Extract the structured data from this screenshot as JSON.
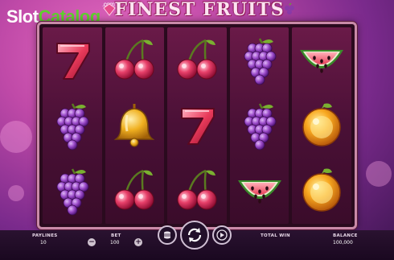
{
  "watermark": {
    "slot": "Slot",
    "catalog": "Catalog",
    "com": ".com"
  },
  "game": {
    "title": "FINEST FRUITS",
    "reels": [
      [
        "seven",
        "grapes",
        "grapes"
      ],
      [
        "cherries",
        "bell",
        "cherries"
      ],
      [
        "cherries",
        "seven",
        "cherries"
      ],
      [
        "grapes",
        "grapes",
        "watermelon"
      ],
      [
        "watermelon",
        "orange",
        "orange"
      ]
    ]
  },
  "controls": {
    "paylines_label": "PAYLINES",
    "paylines_value": "10",
    "bet_label": "BET",
    "bet_value": "100",
    "minus_label": "−",
    "plus_label": "+",
    "total_win_label": "TOTAL WIN",
    "balance_label": "BALANCE",
    "balance_value": "100,000"
  },
  "colors": {
    "background": "#c04aa8",
    "reel_bg": "#4a1036",
    "frame": "#c98aa8",
    "bar": "#1f0c25",
    "watermark_green": "#5fcf2e"
  }
}
